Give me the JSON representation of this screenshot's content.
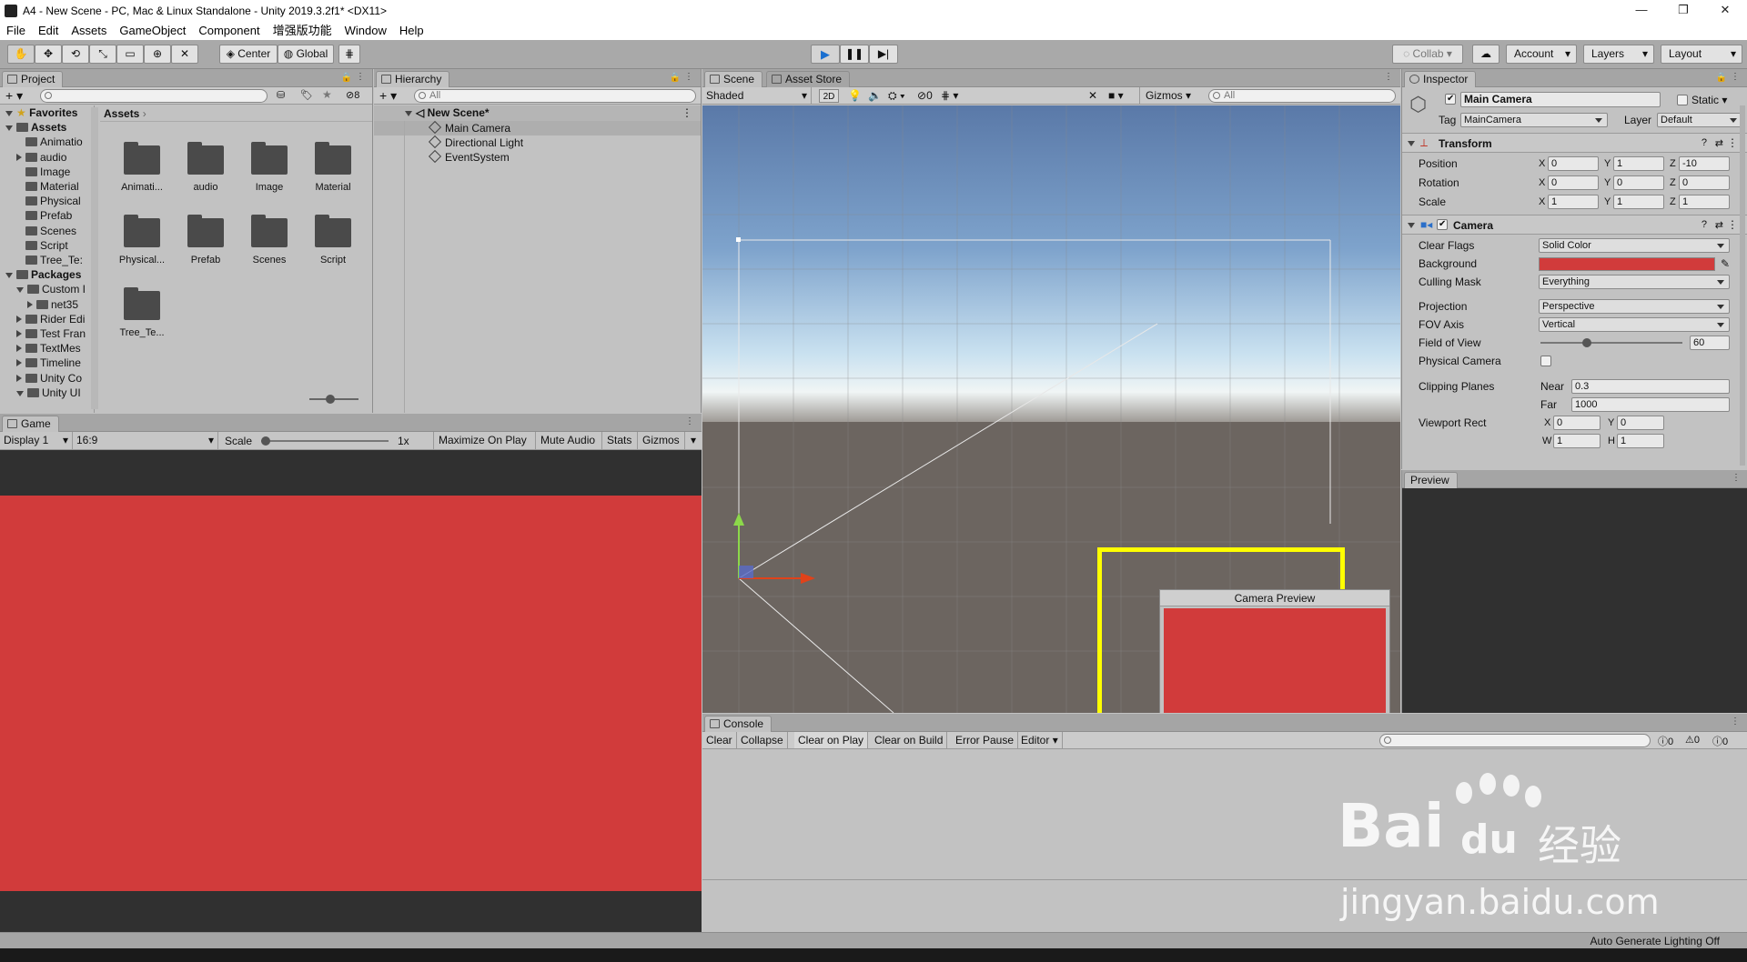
{
  "window": {
    "title": "A4 - New Scene - PC, Mac & Linux Standalone - Unity 2019.3.2f1* <DX11>",
    "minimize": "—",
    "maximize": "❐",
    "close": "✕"
  },
  "menu": [
    "File",
    "Edit",
    "Assets",
    "GameObject",
    "Component",
    "增强版功能",
    "Window",
    "Help"
  ],
  "toolbar": {
    "pivot": "Center",
    "space": "Global",
    "collab": "Collab",
    "account": "Account",
    "layers": "Layers",
    "layout": "Layout"
  },
  "project": {
    "tab": "Project",
    "hidden_count": "8",
    "breadcrumb": "Assets",
    "tree": [
      {
        "label": "Favorites",
        "level": 0,
        "expanded": true,
        "bold": true
      },
      {
        "label": "Assets",
        "level": 0,
        "expanded": true,
        "bold": true
      },
      {
        "label": "Animatio",
        "level": 1
      },
      {
        "label": "audio",
        "level": 1,
        "collapsed": true
      },
      {
        "label": "Image",
        "level": 1
      },
      {
        "label": "Material",
        "level": 1
      },
      {
        "label": "Physical",
        "level": 1
      },
      {
        "label": "Prefab",
        "level": 1
      },
      {
        "label": "Scenes",
        "level": 1
      },
      {
        "label": "Script",
        "level": 1
      },
      {
        "label": "Tree_Te:",
        "level": 1
      },
      {
        "label": "Packages",
        "level": 0,
        "expanded": true,
        "bold": true
      },
      {
        "label": "Custom I",
        "level": 1,
        "expanded": true
      },
      {
        "label": "net35",
        "level": 2,
        "collapsed": true
      },
      {
        "label": "Rider Edi",
        "level": 1,
        "collapsed": true
      },
      {
        "label": "Test Fran",
        "level": 1,
        "collapsed": true
      },
      {
        "label": "TextMes",
        "level": 1,
        "collapsed": true
      },
      {
        "label": "Timeline",
        "level": 1,
        "collapsed": true
      },
      {
        "label": "Unity Co",
        "level": 1,
        "collapsed": true
      },
      {
        "label": "Unity UI",
        "level": 1,
        "expanded": true
      }
    ],
    "folders": [
      "Animati...",
      "audio",
      "Image",
      "Material",
      "Physical...",
      "Prefab",
      "Scenes",
      "Script",
      "Tree_Te..."
    ]
  },
  "hierarchy": {
    "tab": "Hierarchy",
    "search_placeholder": "All",
    "scene": "New Scene*",
    "items": [
      "Main Camera",
      "Directional Light",
      "EventSystem"
    ]
  },
  "game": {
    "tab": "Game",
    "display": "Display 1",
    "aspect": "16:9",
    "scale_label": "Scale",
    "scale_value": "1x",
    "scale_level": 0.0,
    "buttons": [
      "Maximize On Play",
      "Mute Audio",
      "Stats",
      "Gizmos"
    ],
    "background_color": "#d13b3b",
    "letterbox_color": "#303030"
  },
  "scene": {
    "tabs": [
      "Scene",
      "Asset Store"
    ],
    "shading": "Shaded",
    "mode_2d": "2D",
    "hidden_count": "0",
    "gizmos": "Gizmos",
    "search_placeholder": "All",
    "camera_preview_title": "Camera Preview",
    "preview_color": "#d13b3b",
    "highlight_color": "#ffff00"
  },
  "inspector": {
    "tab": "Inspector",
    "object_name": "Main Camera",
    "static_label": "Static",
    "tag_label": "Tag",
    "tag_value": "MainCamera",
    "layer_label": "Layer",
    "layer_value": "Default",
    "transform": {
      "title": "Transform",
      "rows": [
        {
          "label": "Position",
          "x": "0",
          "y": "1",
          "z": "-10"
        },
        {
          "label": "Rotation",
          "x": "0",
          "y": "0",
          "z": "0"
        },
        {
          "label": "Scale",
          "x": "1",
          "y": "1",
          "z": "1"
        }
      ]
    },
    "camera": {
      "title": "Camera",
      "clear_flags_label": "Clear Flags",
      "clear_flags": "Solid Color",
      "background_label": "Background",
      "background_color": "#d13b3b",
      "culling_mask_label": "Culling Mask",
      "culling_mask": "Everything",
      "projection_label": "Projection",
      "projection": "Perspective",
      "fov_axis_label": "FOV Axis",
      "fov_axis": "Vertical",
      "fov_label": "Field of View",
      "fov": "60",
      "fov_level": 0.33,
      "physical_label": "Physical Camera",
      "clipping_label": "Clipping Planes",
      "near_label": "Near",
      "near": "0.3",
      "far_label": "Far",
      "far": "1000",
      "viewport_label": "Viewport Rect",
      "vx": "0",
      "vy": "0",
      "vw": "1",
      "vh": "1"
    },
    "preview_tab": "Preview"
  },
  "console": {
    "tab": "Console",
    "buttons": [
      "Clear",
      "Collapse",
      "Clear on Play",
      "Clear on Build",
      "Error Pause",
      "Editor"
    ],
    "counts": [
      "0",
      "0",
      "0"
    ]
  },
  "statusbar": {
    "text": "Auto Generate Lighting Off"
  },
  "watermark": {
    "logo_text": "Bai",
    "logo_cn": "经验",
    "url": "jingyan.baidu.com"
  }
}
